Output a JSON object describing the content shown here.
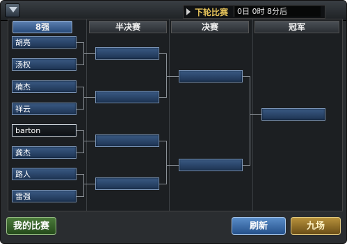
{
  "topbar": {
    "next_round_label": "下轮比赛",
    "countdown": "0日 0时 8分后"
  },
  "columns": [
    "8强",
    "半决赛",
    "决赛",
    "冠军"
  ],
  "round8": [
    {
      "name": "胡亮"
    },
    {
      "name": "汤权"
    },
    {
      "name": "楠杰"
    },
    {
      "name": "祥云"
    },
    {
      "name": "barton",
      "selected": true
    },
    {
      "name": "龚杰"
    },
    {
      "name": "路人"
    },
    {
      "name": "雷强"
    }
  ],
  "semifinal": [
    "",
    "",
    "",
    ""
  ],
  "final": [
    "",
    ""
  ],
  "champion": [
    ""
  ],
  "buttons": {
    "my_matches": "我的比赛",
    "refresh": "刷新",
    "chars": "九场"
  },
  "colors": {
    "slot_blue": "#2b4a72",
    "header_active": "#3f6598",
    "next_round_label": "#e6c35a"
  }
}
